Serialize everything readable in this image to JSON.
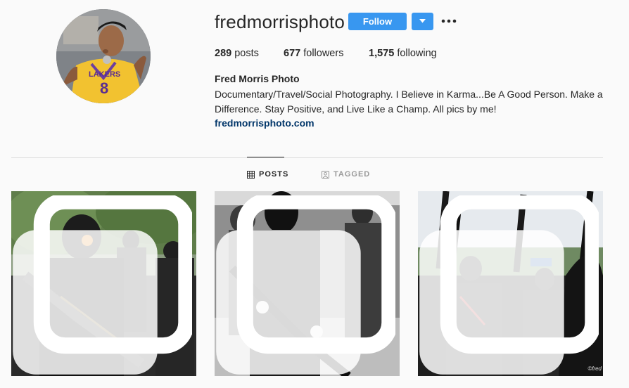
{
  "profile": {
    "username": "fredmorrisphoto",
    "follow_label": "Follow",
    "stats": {
      "posts_count": "289",
      "posts_label": "posts",
      "followers_count": "677",
      "followers_label": "followers",
      "following_count": "1,575",
      "following_label": "following"
    },
    "bio": {
      "name": "Fred Morris Photo",
      "text": "Documentary/Travel/Social Photography. I Believe in Karma...Be A Good Person. Make a Difference. Stay Positive, and Live Like a Champ. All pics by me!",
      "link": "fredmorrisphoto.com"
    }
  },
  "tabs": {
    "posts_label": "Posts",
    "tagged_label": "Tagged"
  },
  "posts": {
    "watermark": "©fred"
  },
  "colors": {
    "accent": "#3897f0",
    "link": "#003569",
    "divider": "#dbdbdb",
    "background": "#fafafa"
  },
  "icons": {
    "dropdown": "chevron-down-icon",
    "more": "more-options-icon",
    "posts_tab": "grid-icon",
    "tagged_tab": "tag-icon",
    "post_type": "multiple-photos-icon"
  }
}
